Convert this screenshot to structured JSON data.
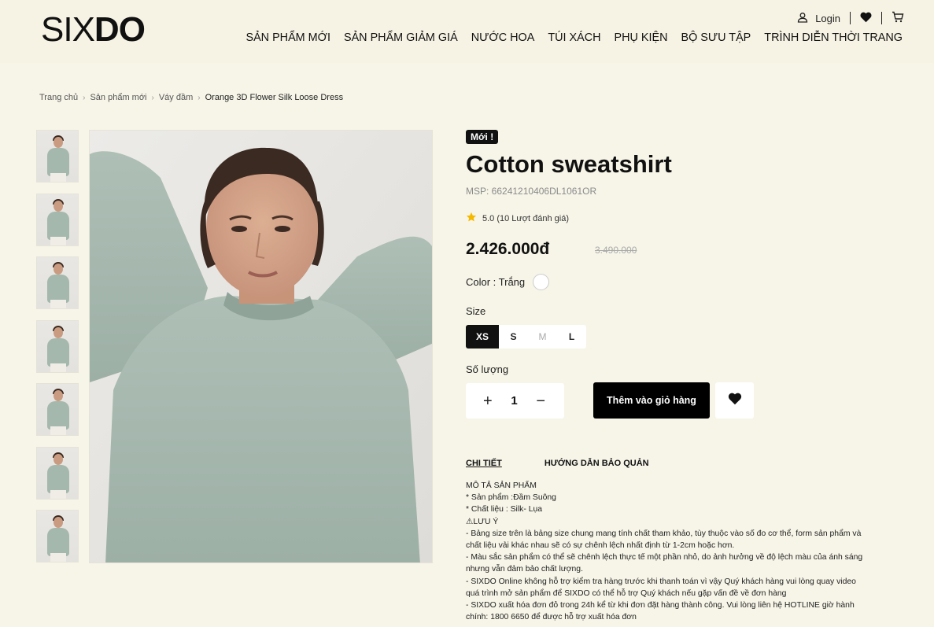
{
  "brand": {
    "logo_light": "SIX",
    "logo_bold": "DO"
  },
  "utility": {
    "login_label": "Login"
  },
  "nav": {
    "items": [
      "SẢN PHẨM MỚI",
      "SẢN PHẨM GIẢM GIÁ",
      "NƯỚC HOA",
      "TÚI XÁCH",
      "PHỤ KIỆN",
      "BỘ SƯU TẬP",
      "TRÌNH DIỄN THỜI TRANG"
    ]
  },
  "breadcrumb": [
    "Trang chủ",
    "Sản phẩm mới",
    "Váy đầm",
    "Orange 3D Flower Silk Loose Dress"
  ],
  "product": {
    "badge": "Mới !",
    "title": "Cotton sweatshirt",
    "sku": "MSP: 66241210406DL1061OR",
    "rating": "5.0 (10 Lượt đánh giá)",
    "price": "2.426.000đ",
    "old_price": "3.490.000",
    "color_label": "Color : Trắng",
    "size_label": "Size",
    "sizes": [
      "XS",
      "S",
      "M",
      "L"
    ],
    "selected_size": "XS",
    "disabled_size": "M",
    "quantity_label": "Số lượng",
    "quantity": "1",
    "add_to_cart": "Thêm vào giỏ hàng",
    "thumbnail_count": 7
  },
  "tabs": [
    "CHI TIẾT",
    "HƯỚNG DẪN BẢO QUẢN"
  ],
  "description": [
    "MÔ TẢ SẢN PHẨM",
    "* Sản phẩm :Đầm Suông",
    "* Chất liệu : Silk- Lụa",
    "⚠LƯU Ý",
    "- Bảng size trên là bảng size chung mang tính chất tham khảo, tùy thuộc vào số đo cơ thể, form sản phẩm và chất liệu vải khác nhau sẽ có sự chênh lệch nhất định từ 1-2cm hoặc hơn.",
    "- Màu sắc sản phẩm có thể sẽ chênh lệch thực tế một phần nhỏ, do ảnh hưởng về độ lệch màu của ánh sáng nhưng vẫn đảm bảo chất lượng.",
    "- SIXDO Online không hỗ trợ kiểm tra hàng trước khi thanh toán vì vậy Quý khách hàng vui lòng quay video quá trình mở sản phẩm để SIXDO có thể hỗ trợ Quý khách nếu gặp vấn đề về đơn hàng",
    "- SIXDO xuất hóa đơn đỏ trong 24h kể từ khi đơn đặt hàng thành công. Vui lòng liên hệ HOTLINE giờ hành chính: 1800 6650 để được hỗ trợ xuất hóa đơn"
  ],
  "colors": {
    "background": "#f7f5e8",
    "primary": "#111111",
    "star": "#f5b800",
    "sweater": "#a5b8ae"
  }
}
